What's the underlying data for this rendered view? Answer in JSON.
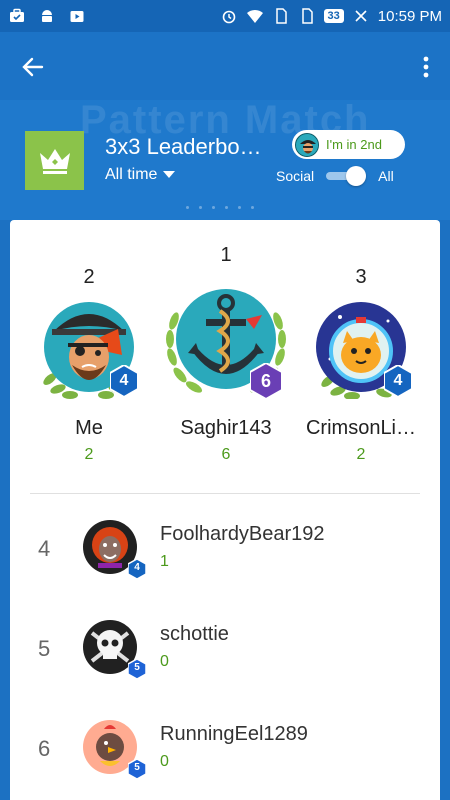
{
  "status_bar": {
    "time": "10:59 PM",
    "battery": "33",
    "left_icons": [
      "briefcase-icon",
      "android-icon",
      "play-store-icon"
    ],
    "right_icons": [
      "alarm-icon",
      "wifi-icon",
      "sim-icon",
      "sim-icon"
    ]
  },
  "app_bar": {
    "back_icon": "arrow-left-icon",
    "menu_icon": "more-vert-icon"
  },
  "header": {
    "watermark": "Pattern Match",
    "title": "3x3 Leaderbo…",
    "time_filter": "All time",
    "rank_pill": "I'm in 2nd",
    "toggle_left": "Social",
    "toggle_right": "All",
    "toggle_on": true
  },
  "podium": [
    {
      "rank": "2",
      "name": "Me",
      "score": "2",
      "level": "4"
    },
    {
      "rank": "1",
      "name": "Saghir143",
      "score": "6",
      "level": "6"
    },
    {
      "rank": "3",
      "name": "CrimsonLi…",
      "score": "2",
      "level": "4"
    }
  ],
  "list": [
    {
      "rank": "4",
      "name": "FoolhardyBear192",
      "score": "1",
      "level": "4"
    },
    {
      "rank": "5",
      "name": "schottie",
      "score": "0",
      "level": "5"
    },
    {
      "rank": "6",
      "name": "RunningEel1289",
      "score": "0",
      "level": "5"
    }
  ],
  "colors": {
    "primary": "#1c73c6",
    "accent_green": "#8bc34a",
    "score_green": "#4c9a1c",
    "hex_blue": "#1565c0",
    "hex_purple": "#6a3fb5"
  }
}
